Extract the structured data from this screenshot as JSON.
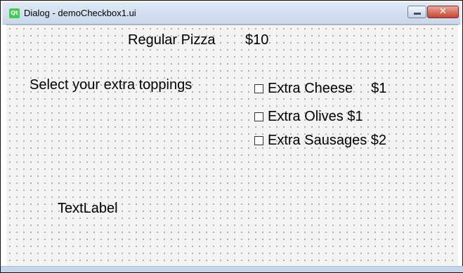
{
  "window": {
    "title": "Dialog - demoCheckbox1.ui",
    "app_icon_text": "Qt",
    "close_glyph": "✕"
  },
  "form": {
    "pizza_label": "Regular Pizza",
    "pizza_price": "$10",
    "toppings_prompt": "Select your extra toppings",
    "checkboxes": [
      {
        "label": "Extra Cheese",
        "price": "$1",
        "checked": false
      },
      {
        "label": "Extra Olives $1",
        "checked": false
      },
      {
        "label": "Extra Sausages $2",
        "checked": false
      }
    ],
    "text_label": "TextLabel"
  },
  "colors": {
    "title_bar": "#c8d7ea",
    "close_button": "#c7452f",
    "qt_green": "#41cd52",
    "canvas": "#f3f3f3"
  }
}
